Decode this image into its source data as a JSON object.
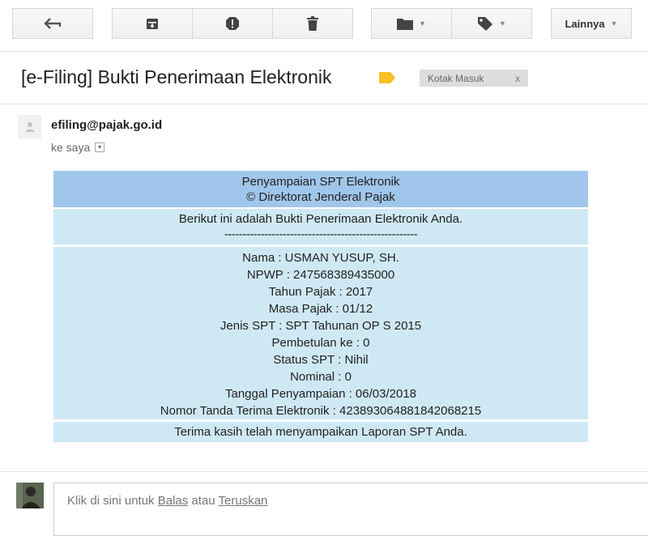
{
  "toolbar": {
    "more_label": "Lainnya"
  },
  "subject": "[e-Filing] Bukti Penerimaan Elektronik",
  "label_tag": {
    "text": "Kotak Masuk",
    "remove": "x"
  },
  "sender": {
    "email": "efiling@pajak.go.id",
    "recipient_text": "ke saya"
  },
  "receipt": {
    "header_line1": "Penyampaian SPT Elektronik",
    "header_line2": "© Direktorat Jenderal Pajak",
    "intro_line": "Berikut ini adalah Bukti Penerimaan Elektronik Anda.",
    "intro_rule": "-----------------------------------------------------",
    "details": [
      "Nama : USMAN YUSUP, SH.",
      "NPWP : 247568389435000",
      "Tahun Pajak : 2017",
      "Masa Pajak : 01/12",
      "Jenis SPT : SPT Tahunan OP S 2015",
      "Pembetulan ke : 0",
      "Status SPT : Nihil",
      "Nominal : 0",
      "Tanggal Penyampaian : 06/03/2018",
      "Nomor Tanda Terima Elektronik : 423893064881842068215"
    ],
    "thanks": "Terima kasih telah menyampaikan Laporan SPT Anda."
  },
  "reply": {
    "prefix": "Klik di sini untuk ",
    "reply_link": "Balas",
    "middle": " atau ",
    "forward_link": "Teruskan"
  },
  "colors": {
    "header_bg": "#a0c6ec",
    "row_bg": "#cfe9f4",
    "label_important": "#f6c026"
  }
}
